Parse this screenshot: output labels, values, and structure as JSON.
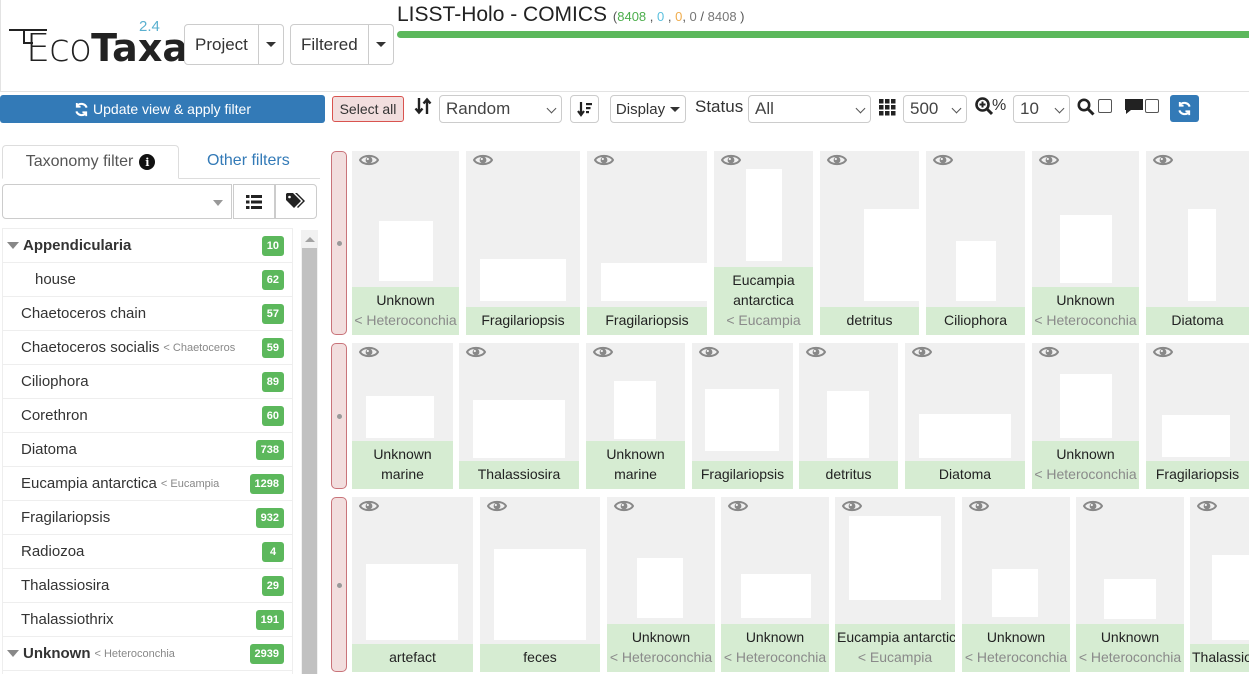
{
  "app": {
    "name_light": "Eco",
    "name_bold": "Taxa",
    "version": "2.4"
  },
  "header": {
    "project_button": "Project",
    "filtered_button": "Filtered",
    "project_title": "LISST-Holo - COMICS",
    "stats": {
      "validated": "8408",
      "predicted": "0",
      "dubious": "0",
      "unclassified": "0",
      "total": "8408"
    },
    "progress_fraction": 1.0
  },
  "toolbar": {
    "update_button": "Update view & apply filter",
    "select_all_button": "Select all",
    "sort_value": "Random",
    "display_button": "Display",
    "status_label": "Status",
    "status_value": "All",
    "page_size_value": "500",
    "zoom_label": "%",
    "zoom_value": "10"
  },
  "left_panel": {
    "tab_taxonomy": "Taxonomy filter",
    "tab_other": "Other filters",
    "taxonomy_input_value": "",
    "tree": [
      {
        "name": "Appendicularia",
        "parent": "",
        "count": "10",
        "bold": true,
        "expanded": true,
        "indent": 0
      },
      {
        "name": "house",
        "parent": "",
        "count": "62",
        "bold": false,
        "expanded": false,
        "indent": 1
      },
      {
        "name": "Chaetoceros chain",
        "parent": "",
        "count": "57",
        "bold": false,
        "expanded": false,
        "indent": 0
      },
      {
        "name": "Chaetoceros socialis",
        "parent": "< Chaetoceros",
        "count": "59",
        "bold": false,
        "expanded": false,
        "indent": 0
      },
      {
        "name": "Ciliophora",
        "parent": "",
        "count": "89",
        "bold": false,
        "expanded": false,
        "indent": 0
      },
      {
        "name": "Corethron",
        "parent": "",
        "count": "60",
        "bold": false,
        "expanded": false,
        "indent": 0
      },
      {
        "name": "Diatoma",
        "parent": "",
        "count": "738",
        "bold": false,
        "expanded": false,
        "indent": 0
      },
      {
        "name": "Eucampia antarctica",
        "parent": "< Eucampia",
        "count": "1298",
        "bold": false,
        "expanded": false,
        "indent": 0
      },
      {
        "name": "Fragilariopsis",
        "parent": "",
        "count": "932",
        "bold": false,
        "expanded": false,
        "indent": 0
      },
      {
        "name": "Radiozoa",
        "parent": "",
        "count": "4",
        "bold": false,
        "expanded": false,
        "indent": 0
      },
      {
        "name": "Thalassiosira",
        "parent": "",
        "count": "29",
        "bold": false,
        "expanded": false,
        "indent": 0
      },
      {
        "name": "Thalassiothrix",
        "parent": "",
        "count": "191",
        "bold": false,
        "expanded": false,
        "indent": 0
      },
      {
        "name": "Unknown",
        "parent": "< Heteroconchia",
        "count": "2939",
        "bold": true,
        "expanded": true,
        "indent": 0
      }
    ]
  },
  "grid": {
    "rows": [
      [
        {
          "label": "Unknown",
          "sub": "< Heteroconchia"
        },
        {
          "label": "Fragilariopsis",
          "sub": ""
        },
        {
          "label": "Fragilariopsis",
          "sub": ""
        },
        {
          "label": "Eucampia antarctica",
          "sub": "< Eucampia"
        },
        {
          "label": "detritus",
          "sub": ""
        },
        {
          "label": "Ciliophora",
          "sub": ""
        },
        {
          "label": "Unknown",
          "sub": "< Heteroconchia"
        },
        {
          "label": "Diatoma",
          "sub": ""
        }
      ],
      [
        {
          "label": "Unknown marine",
          "sub": ""
        },
        {
          "label": "Thalassiosira",
          "sub": ""
        },
        {
          "label": "Unknown marine",
          "sub": ""
        },
        {
          "label": "Fragilariopsis",
          "sub": ""
        },
        {
          "label": "detritus",
          "sub": ""
        },
        {
          "label": "Diatoma",
          "sub": ""
        },
        {
          "label": "Unknown",
          "sub": "< Heteroconchia"
        },
        {
          "label": "Fragilariopsis",
          "sub": ""
        }
      ],
      [
        {
          "label": "artefact",
          "sub": ""
        },
        {
          "label": "feces",
          "sub": ""
        },
        {
          "label": "Unknown",
          "sub": "< Heteroconchia"
        },
        {
          "label": "Unknown",
          "sub": "< Heteroconchia"
        },
        {
          "label": "Eucampia antarctica",
          "sub": "< Eucampia"
        },
        {
          "label": "Unknown",
          "sub": "< Heteroconchia"
        },
        {
          "label": "Unknown",
          "sub": "< Heteroconchia"
        },
        {
          "label": "Thalassiothrix",
          "sub": ""
        }
      ]
    ]
  },
  "colors": {
    "primary": "#337ab7",
    "validated": "#5cb85c",
    "caption_bg": "#d6ecd2",
    "select_all_bg": "#f2dede"
  }
}
